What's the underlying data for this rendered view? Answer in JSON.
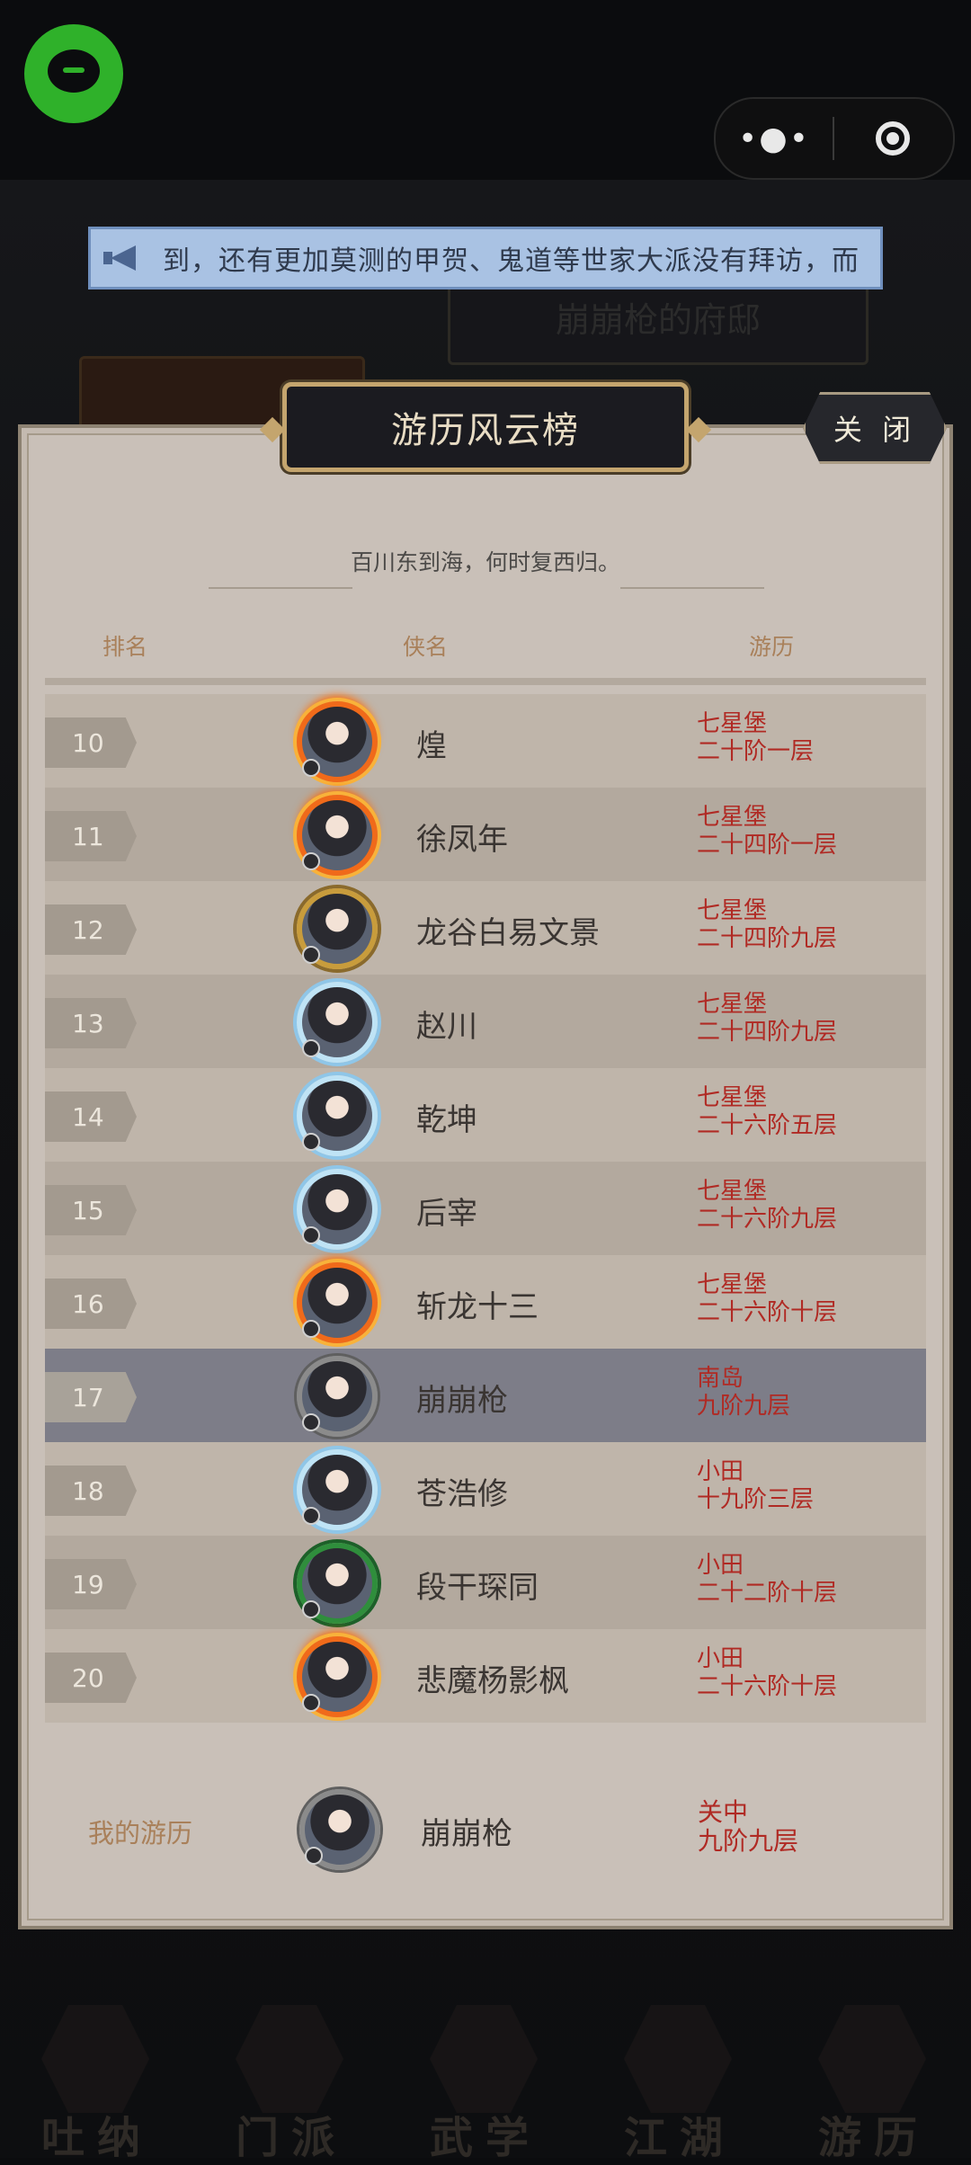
{
  "marquee": {
    "text": "到，还有更加莫测的甲贺、鬼道等世家大派没有拜访，而"
  },
  "background": {
    "mansion_label": "崩崩枪的府邸"
  },
  "panel": {
    "title": "游历风云榜",
    "close_label": "关 闭",
    "subtitle": "百川东到海，何时复西归。",
    "headers": {
      "rank": "排名",
      "name": "侠名",
      "progress": "游历"
    }
  },
  "ranking": [
    {
      "rank": "10",
      "name": "煌",
      "place": "七星堡",
      "level": "二十阶一层",
      "frame": "fire"
    },
    {
      "rank": "11",
      "name": "徐凤年",
      "place": "七星堡",
      "level": "二十四阶一层",
      "frame": "fire"
    },
    {
      "rank": "12",
      "name": "龙谷白易文景",
      "place": "七星堡",
      "level": "二十四阶九层",
      "frame": "gold"
    },
    {
      "rank": "13",
      "name": "赵川",
      "place": "七星堡",
      "level": "二十四阶九层",
      "frame": "ice"
    },
    {
      "rank": "14",
      "name": "乾坤",
      "place": "七星堡",
      "level": "二十六阶五层",
      "frame": "ice"
    },
    {
      "rank": "15",
      "name": "后宰",
      "place": "七星堡",
      "level": "二十六阶九层",
      "frame": "ice"
    },
    {
      "rank": "16",
      "name": "斩龙十三",
      "place": "七星堡",
      "level": "二十六阶十层",
      "frame": "fire"
    },
    {
      "rank": "17",
      "name": "崩崩枪",
      "place": "南岛",
      "level": "九阶九层",
      "frame": "silver",
      "highlight": true
    },
    {
      "rank": "18",
      "name": "苍浩修",
      "place": "小田",
      "level": "十九阶三层",
      "frame": "ice"
    },
    {
      "rank": "19",
      "name": "段干琛同",
      "place": "小田",
      "level": "二十二阶十层",
      "frame": "jade"
    },
    {
      "rank": "20",
      "name": "悲魔杨影枫",
      "place": "小田",
      "level": "二十六阶十层",
      "frame": "fire"
    }
  ],
  "my_record": {
    "label": "我的游历",
    "name": "崩崩枪",
    "place": "关中",
    "level": "九阶九层"
  },
  "bottom_nav": [
    {
      "label": "吐纳"
    },
    {
      "label": "门派"
    },
    {
      "label": "武学"
    },
    {
      "label": "江湖"
    },
    {
      "label": "游历"
    }
  ]
}
